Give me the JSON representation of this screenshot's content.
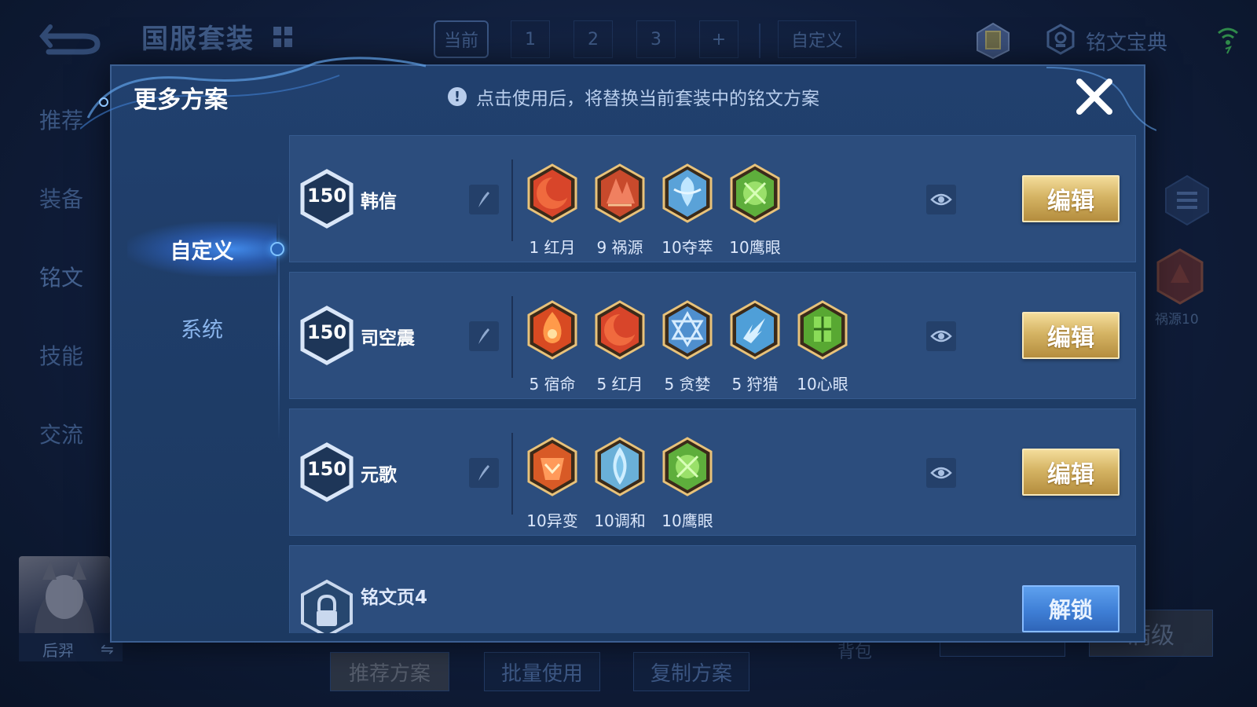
{
  "app": {
    "title": "国服套装",
    "tabs": [
      "当前",
      "1",
      "2",
      "3",
      "+",
      "自定义"
    ],
    "codex_label": "铭文宝典",
    "side_nav": [
      "推荐",
      "装备",
      "铭文",
      "技能",
      "交流"
    ],
    "hero_name": "后羿",
    "right_rune_label": "祸源10",
    "bottom_buttons": [
      "推荐方案",
      "批量使用",
      "复制方案",
      "满级"
    ],
    "bag_label": "背包"
  },
  "modal": {
    "title": "更多方案",
    "notice": "点击使用后，将替换当前套装中的铭文方案",
    "tabs": [
      "自定义",
      "系统"
    ],
    "rows": [
      {
        "level": "150",
        "name": "韩信",
        "runes": [
          {
            "count": "1",
            "name": "红月",
            "icon": "red-moon",
            "color": "#d8452a"
          },
          {
            "count": "9",
            "name": "祸源",
            "icon": "calamity-source",
            "color": "#c84a2c"
          },
          {
            "count": "10",
            "name": "夺萃",
            "icon": "plunder",
            "color": "#5aa2d8"
          },
          {
            "count": "10",
            "name": "鹰眼",
            "icon": "eagle-eye",
            "color": "#5eae3c"
          }
        ],
        "edit_label": "编辑"
      },
      {
        "level": "150",
        "name": "司空震",
        "runes": [
          {
            "count": "5",
            "name": "宿命",
            "icon": "fate",
            "color": "#d84a22"
          },
          {
            "count": "5",
            "name": "红月",
            "icon": "red-moon",
            "color": "#d8452a"
          },
          {
            "count": "5",
            "name": "贪婪",
            "icon": "greed",
            "color": "#4f8fce"
          },
          {
            "count": "5",
            "name": "狩猎",
            "icon": "hunt",
            "color": "#4f9fd8"
          },
          {
            "count": "10",
            "name": "心眼",
            "icon": "mind-eye",
            "color": "#58a832"
          }
        ],
        "edit_label": "编辑"
      },
      {
        "level": "150",
        "name": "元歌",
        "runes": [
          {
            "count": "10",
            "name": "异变",
            "icon": "mutation",
            "color": "#d85a26"
          },
          {
            "count": "10",
            "name": "调和",
            "icon": "harmony",
            "color": "#6ab0d8"
          },
          {
            "count": "10",
            "name": "鹰眼",
            "icon": "eagle-eye",
            "color": "#5eae3c"
          }
        ],
        "edit_label": "编辑"
      }
    ],
    "locked_row": {
      "name": "铭文页4",
      "unlock_label": "解锁"
    }
  }
}
